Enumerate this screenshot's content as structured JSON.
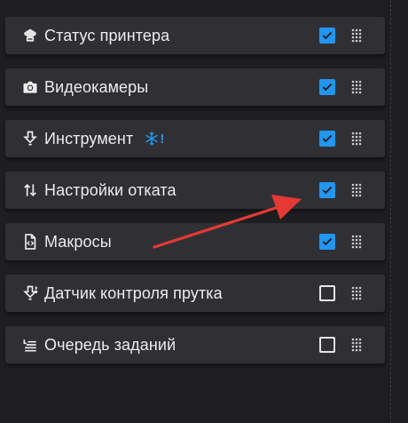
{
  "panels": [
    {
      "label": "Статус принтера",
      "icon": "printer-icon",
      "checked": true
    },
    {
      "label": "Видеокамеры",
      "icon": "camera-icon",
      "checked": true
    },
    {
      "label": "Инструмент",
      "icon": "tool-download-icon",
      "checked": true,
      "badge": {
        "icon": "snowflake-warning-icon",
        "text": "!"
      }
    },
    {
      "label": "Настройки отката",
      "icon": "swap-vertical-icon",
      "checked": true
    },
    {
      "label": "Макросы",
      "icon": "code-file-icon",
      "checked": true
    },
    {
      "label": "Датчик контроля прутка",
      "icon": "filament-sensor-icon",
      "checked": false
    },
    {
      "label": "Очередь заданий",
      "icon": "queue-list-icon",
      "checked": false
    }
  ],
  "colors": {
    "background": "#1e1e20",
    "panel": "#303034",
    "accent": "#2196f3",
    "annotation_arrow": "#e53935"
  }
}
